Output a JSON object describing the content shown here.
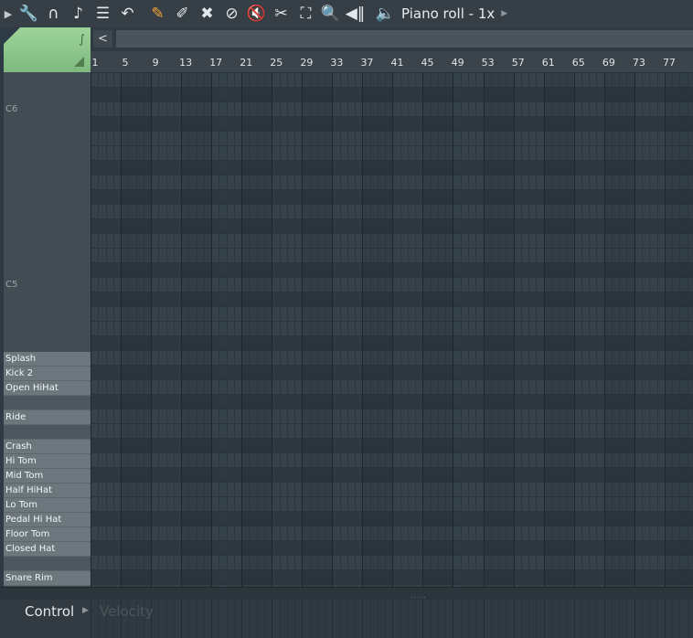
{
  "toolbar": {
    "tools": [
      {
        "name": "menu-arrow-icon",
        "glyph": "▶",
        "accent": false
      },
      {
        "name": "wrench-icon",
        "glyph": "🔧",
        "accent": false
      },
      {
        "name": "magnet-icon",
        "glyph": "∩",
        "accent": false
      },
      {
        "name": "note-icon",
        "glyph": "♪",
        "accent": false
      },
      {
        "name": "list-icon",
        "glyph": "☰",
        "accent": false
      },
      {
        "name": "undo-icon",
        "glyph": "↶",
        "accent": false
      },
      {
        "name": "pencil-tool-icon",
        "glyph": "✎",
        "accent": true
      },
      {
        "name": "paint-brush-icon",
        "glyph": "✐",
        "accent": false
      },
      {
        "name": "erase-icon",
        "glyph": "✖",
        "accent": false
      },
      {
        "name": "no-entry-icon",
        "glyph": "⊘",
        "accent": false
      },
      {
        "name": "mute-icon",
        "glyph": "🔇",
        "accent": false
      },
      {
        "name": "slice-icon",
        "glyph": "✂",
        "accent": false
      },
      {
        "name": "select-icon",
        "glyph": "⛶",
        "accent": false
      },
      {
        "name": "zoom-icon",
        "glyph": "🔍",
        "accent": false
      },
      {
        "name": "playback-icon",
        "glyph": "◀‖",
        "accent": false
      }
    ],
    "speaker_glyph": "🔈",
    "title": "Piano roll - 1x",
    "title_arrow": "▶"
  },
  "left_panel": {
    "curve_glyph": "∫",
    "scroll_left_glyph": "<"
  },
  "ruler": {
    "bars": [
      "1",
      "5",
      "9",
      "13",
      "17",
      "21",
      "25",
      "29",
      "33",
      "37",
      "41",
      "45",
      "49",
      "53",
      "57",
      "61",
      "65",
      "69",
      "73",
      "77"
    ]
  },
  "keyboard": {
    "octave_labels": [
      "C6",
      "C5"
    ],
    "drum_rows": [
      "Splash",
      "Kick 2",
      "Open HiHat",
      "",
      "Ride",
      "",
      "Crash",
      "Hi Tom",
      "Mid Tom",
      "Half HiHat",
      "Lo Tom",
      "Pedal Hi Hat",
      "Floor Tom",
      "Closed Hat",
      "",
      "Snare Rim"
    ]
  },
  "bottom": {
    "control_label": "Control",
    "control_arrow": "▶",
    "target_label": "Velocity",
    "grip": "....."
  },
  "colors": {
    "accent_tool": "#f2a533",
    "tool_block_green": "#8fc78e",
    "grid_bg": "#344048"
  }
}
